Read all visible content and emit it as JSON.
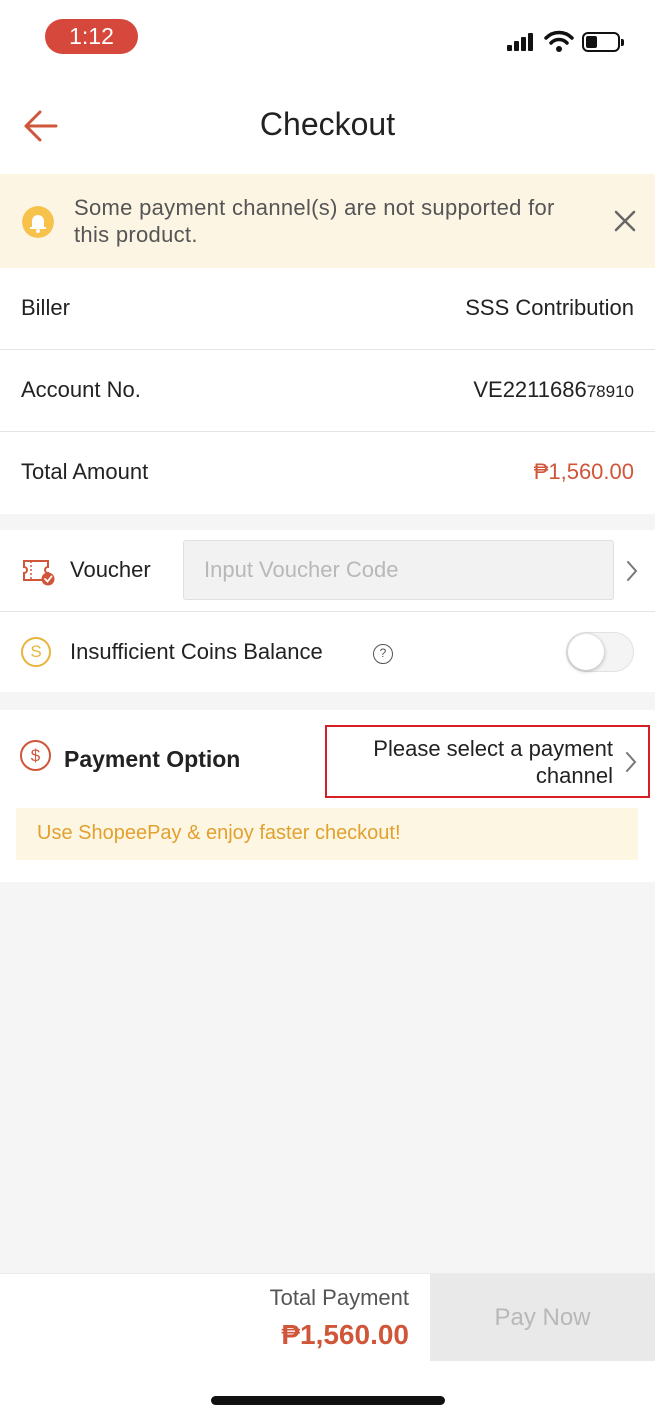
{
  "status_bar": {
    "time": "1:12"
  },
  "header": {
    "title": "Checkout"
  },
  "notice": {
    "text": "Some payment channel(s) are not supported for this product."
  },
  "details": {
    "biller_label": "Biller",
    "biller_value": "SSS Contribution",
    "account_label": "Account No.",
    "account_value": "VE2211686",
    "account_value_suffix": "78910",
    "total_label": "Total Amount",
    "total_value": "₱1,560.00"
  },
  "voucher": {
    "label": "Voucher",
    "placeholder": "Input Voucher Code"
  },
  "coins": {
    "icon_glyph": "S",
    "label": "Insufficient Coins Balance",
    "help_glyph": "?",
    "enabled": false
  },
  "payment": {
    "icon_glyph": "$",
    "label": "Payment Option",
    "select_text": "Please select a payment channel",
    "promo": "Use ShopeePay & enjoy faster checkout!"
  },
  "footer": {
    "total_label": "Total Payment",
    "total_value": "₱1,560.00",
    "pay_button": "Pay Now"
  },
  "colors": {
    "brand": "#d0563a",
    "highlight_border": "#d51f27",
    "notice_bg": "#fdf5e4",
    "promo_text": "#e2a02f"
  }
}
